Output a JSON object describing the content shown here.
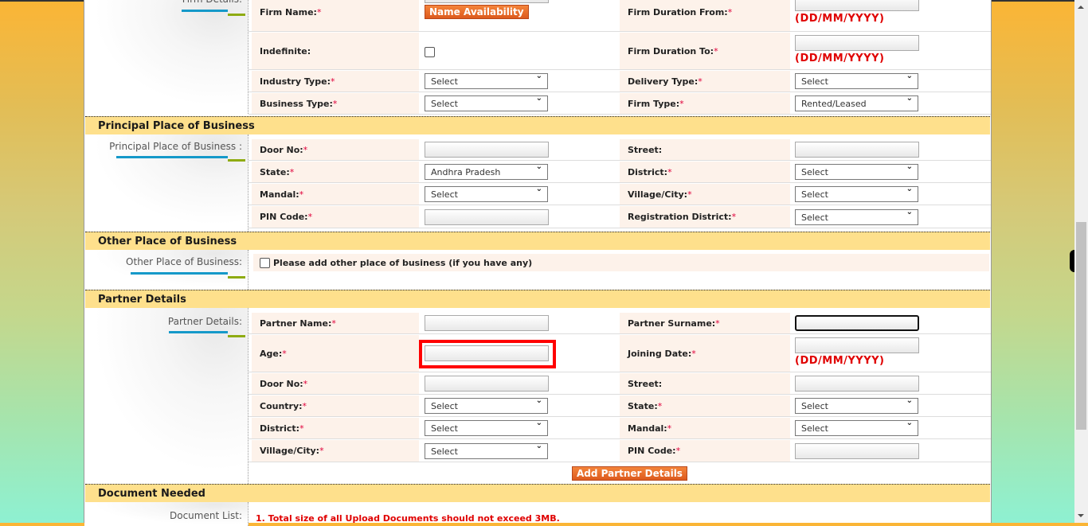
{
  "firm_details": {
    "side_label": "Firm Details:",
    "rows": [
      {
        "left_label": "Firm Name:",
        "left_required": true,
        "left_type": "text-with-button",
        "left_button": "Name Availability",
        "right_label": "Firm Duration From:",
        "right_required": true,
        "right_type": "date",
        "right_hint": "(DD/MM/YYYY)"
      },
      {
        "left_label": "Indefinite:",
        "left_required": false,
        "left_type": "checkbox",
        "right_label": "Firm Duration To:",
        "right_required": true,
        "right_type": "date",
        "right_hint": "(DD/MM/YYYY)"
      },
      {
        "left_label": "Industry Type:",
        "left_required": true,
        "left_type": "select",
        "left_value": "Select",
        "right_label": "Delivery Type:",
        "right_required": true,
        "right_type": "select",
        "right_value": "Select"
      },
      {
        "left_label": "Business Type:",
        "left_required": true,
        "left_type": "select",
        "left_value": "Select",
        "right_label": "Firm Type:",
        "right_required": true,
        "right_type": "select",
        "right_value": "Rented/Leased"
      }
    ]
  },
  "principal_place": {
    "title": "Principal Place of Business",
    "side_label": "Principal Place of Business :",
    "rows": [
      {
        "left_label": "Door No:",
        "left_required": true,
        "left_type": "text",
        "right_label": "Street:",
        "right_required": false,
        "right_type": "text"
      },
      {
        "left_label": "State:",
        "left_required": true,
        "left_type": "select",
        "left_value": "Andhra Pradesh",
        "right_label": "District:",
        "right_required": true,
        "right_type": "select",
        "right_value": "Select"
      },
      {
        "left_label": "Mandal:",
        "left_required": true,
        "left_type": "select",
        "left_value": "Select",
        "right_label": "Village/City:",
        "right_required": true,
        "right_type": "select",
        "right_value": "Select"
      },
      {
        "left_label": "PIN Code:",
        "left_required": true,
        "left_type": "text",
        "right_label": "Registration District:",
        "right_required": true,
        "right_type": "select",
        "right_value": "Select"
      }
    ]
  },
  "other_place": {
    "title": "Other Place of Business",
    "side_label": "Other Place of Business:",
    "checkbox_label": "Please add other place of business (if you have any)"
  },
  "partner_details": {
    "title": "Partner Details",
    "side_label": "Partner Details:",
    "rows": [
      {
        "left_label": "Partner Name:",
        "left_required": true,
        "left_type": "text",
        "right_label": "Partner Surname:",
        "right_required": true,
        "right_type": "text-focused"
      },
      {
        "left_label": "Age:",
        "left_required": true,
        "left_type": "text-highlighted",
        "right_label": "Joining Date:",
        "right_required": true,
        "right_type": "date",
        "right_hint": "(DD/MM/YYYY)"
      },
      {
        "left_label": "Door No:",
        "left_required": true,
        "left_type": "text",
        "right_label": "Street:",
        "right_required": false,
        "right_type": "text"
      },
      {
        "left_label": "Country:",
        "left_required": true,
        "left_type": "select",
        "left_value": "Select",
        "right_label": "State:",
        "right_required": true,
        "right_type": "select",
        "right_value": "Select"
      },
      {
        "left_label": "District:",
        "left_required": true,
        "left_type": "select",
        "left_value": "Select",
        "right_label": "Mandal:",
        "right_required": true,
        "right_type": "select",
        "right_value": "Select"
      },
      {
        "left_label": "Village/City:",
        "left_required": true,
        "left_type": "select",
        "left_value": "Select",
        "right_label": "PIN Code:",
        "right_required": true,
        "right_type": "text"
      }
    ],
    "add_button": "Add Partner Details"
  },
  "documents": {
    "title": "Document Needed",
    "side_label": "Document List:",
    "notes": [
      "1. Total size of all Upload Documents should not exceed 3MB."
    ]
  },
  "required_marker": "*",
  "colors": {
    "section_header": "#fee08c",
    "label_cell": "#fdf2ea",
    "button_orange": "#e8692a",
    "required": "#e0003a",
    "hint_red": "#e00000",
    "highlight": "#ff0000",
    "accent_blue": "#1599c9",
    "accent_green": "#8eab12"
  }
}
